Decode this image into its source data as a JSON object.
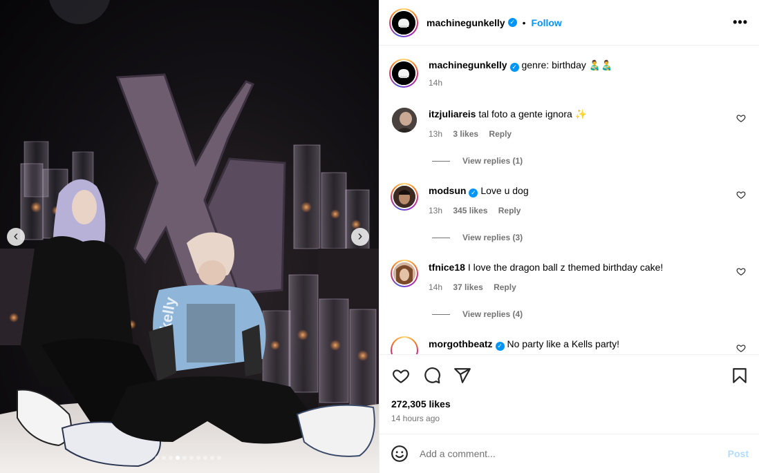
{
  "post": {
    "author": "machinegunkelly",
    "follow_label": "Follow",
    "separator": "•",
    "more_label": "•••",
    "verified_mark": "✓",
    "caption": {
      "user": "machinegunkelly",
      "text": "genre: birthday 👨‍🍼👨‍🍼",
      "time": "14h"
    },
    "likes": "272,305 likes",
    "time_ago": "14 hours ago"
  },
  "photo": {
    "letter": "X",
    "shirt_text": "kelly",
    "carousel_prev": "‹",
    "carousel_next": "›"
  },
  "comments": [
    {
      "user": "itzjuliareis",
      "verified": false,
      "text": "tal foto a gente ignora ✨",
      "time": "13h",
      "likes": "3 likes",
      "reply": "Reply",
      "view_replies": "View replies (1)"
    },
    {
      "user": "modsun",
      "verified": true,
      "text": "Love u dog",
      "time": "13h",
      "likes": "345 likes",
      "reply": "Reply",
      "view_replies": "View replies (3)"
    },
    {
      "user": "tfnice18",
      "verified": false,
      "text": "I love the dragon ball z themed birthday cake!",
      "time": "14h",
      "likes": "37 likes",
      "reply": "Reply",
      "view_replies": "View replies (4)"
    },
    {
      "user": "morgothbeatz",
      "verified": true,
      "text": "No party like a Kells party!"
    }
  ],
  "composer": {
    "placeholder": "Add a comment...",
    "post_label": "Post"
  },
  "icons": {
    "like": "heart-icon",
    "comment": "comment-icon",
    "share": "share-icon",
    "save": "bookmark-icon",
    "emoji": "emoji-icon"
  },
  "colors": {
    "accent": "#0095f6",
    "post_disabled": "#b3dbff",
    "meta": "#737373"
  }
}
